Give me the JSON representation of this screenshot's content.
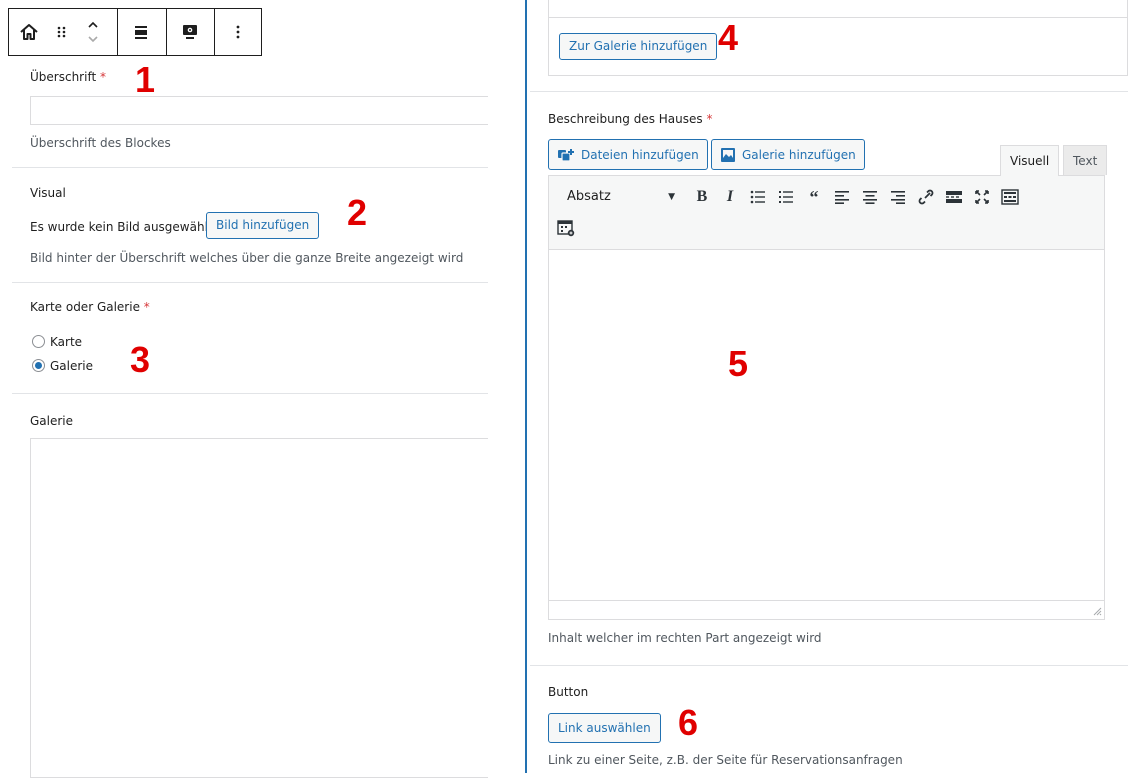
{
  "toolbar": {
    "buttons": [
      {
        "name": "block-type-icon"
      },
      {
        "name": "drag-handle-icon"
      },
      {
        "name": "move-up-down-icon"
      },
      {
        "name": "align-icon"
      },
      {
        "name": "preview-icon"
      },
      {
        "name": "more-options-icon"
      }
    ]
  },
  "left": {
    "heading": {
      "label": "Überschrift",
      "required": "*",
      "value": "",
      "description": "Überschrift des Blockes"
    },
    "visual": {
      "label": "Visual",
      "status": "Es wurde kein Bild ausgewählt",
      "button": "Bild hinzufügen",
      "description": "Bild hinter der Überschrift welches über die ganze Breite angezeigt wird"
    },
    "map_or_gallery": {
      "label": "Karte oder Galerie",
      "required": "*",
      "options": [
        "Karte",
        "Galerie"
      ],
      "selected": "Galerie"
    },
    "gallery": {
      "label": "Galerie"
    }
  },
  "right": {
    "add_to_gallery_button": "Zur Galerie hinzufügen",
    "description_field": {
      "label": "Beschreibung des Hauses",
      "required": "*",
      "add_files_button": "Dateien hinzufügen",
      "add_gallery_button": "Galerie hinzufügen",
      "tabs": [
        "Visuell",
        "Text"
      ],
      "active_tab": "Visuell",
      "format_select": "Absatz",
      "tools": [
        "bold-icon",
        "italic-icon",
        "bullet-list-icon",
        "numbered-list-icon",
        "blockquote-icon",
        "align-left-icon",
        "align-center-icon",
        "align-right-icon",
        "link-icon",
        "read-more-icon",
        "fullscreen-icon",
        "toolbar-toggle-icon",
        "table-icon"
      ],
      "content": "",
      "hint": "Inhalt welcher im rechten Part angezeigt wird"
    },
    "button_field": {
      "label": "Button",
      "button": "Link auswählen",
      "description": "Link zu einer Seite, z.B. der Seite für Reservationsanfragen"
    }
  },
  "annotations": [
    "1",
    "2",
    "3",
    "4",
    "5",
    "6"
  ],
  "colors": {
    "accent": "#2271b1",
    "divider": "#2271b1",
    "annotation": "#e00000",
    "required": "#d63638"
  }
}
